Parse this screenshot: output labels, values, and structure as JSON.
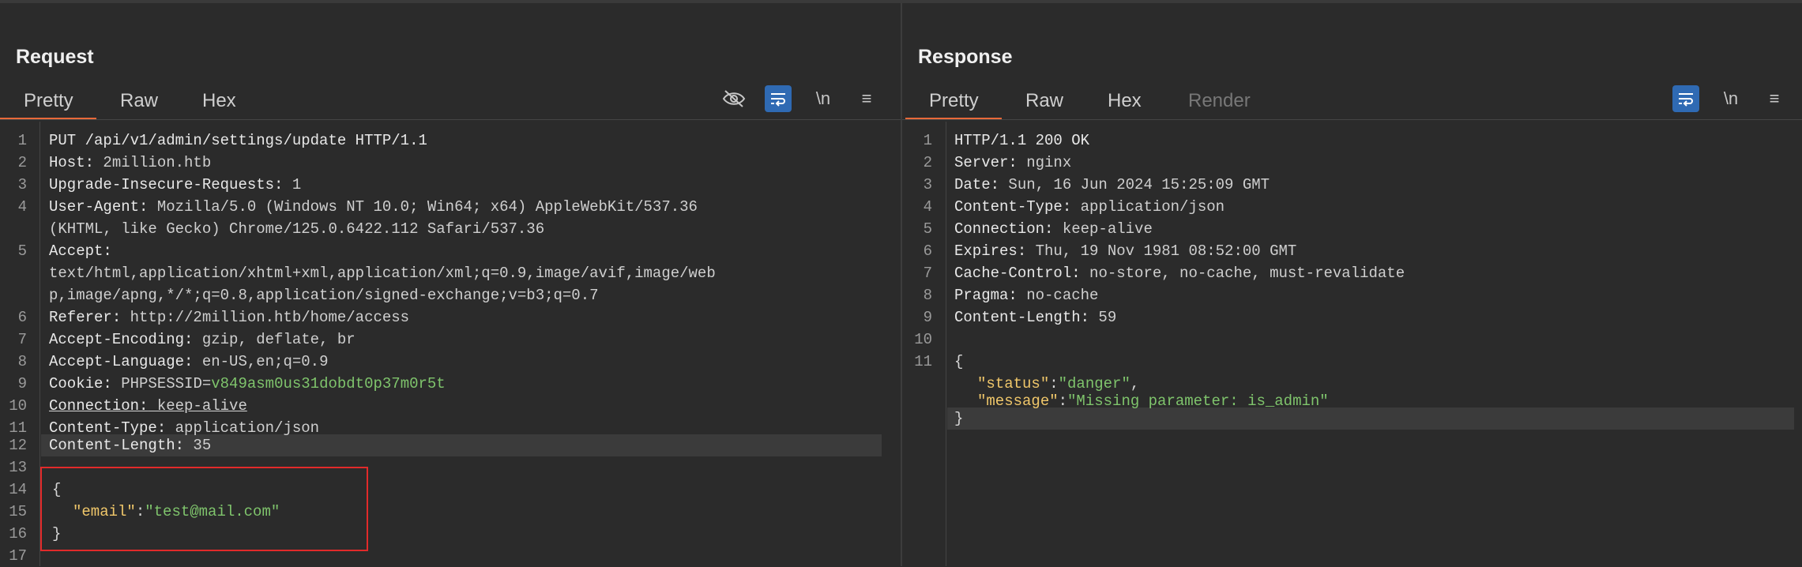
{
  "layout_switch": {
    "icons": [
      "split-horizontal-icon",
      "split-vertical-icon",
      "single-pane-icon"
    ],
    "active": 0
  },
  "request": {
    "title": "Request",
    "tabs": [
      {
        "label": "Pretty",
        "active": true
      },
      {
        "label": "Raw",
        "active": false
      },
      {
        "label": "Hex",
        "active": false
      }
    ],
    "toolbar": {
      "newline_label": "\\n",
      "menu_label": "≡"
    },
    "lines": [
      {
        "n": "1",
        "text": "PUT /api/v1/admin/settings/update HTTP/1.1"
      },
      {
        "n": "2",
        "name": "Host:",
        "value": " 2million.htb"
      },
      {
        "n": "3",
        "name": "Upgrade-Insecure-Requests:",
        "value": " 1"
      },
      {
        "n": "4",
        "name": "User-Agent:",
        "value": " Mozilla/5.0 (Windows NT 10.0; Win64; x64) AppleWebKit/537.36"
      },
      {
        "n": "",
        "text": "(KHTML, like Gecko) Chrome/125.0.6422.112 Safari/537.36"
      },
      {
        "n": "5",
        "name": "Accept:",
        "value": ""
      },
      {
        "n": "",
        "text": "text/html,application/xhtml+xml,application/xml;q=0.9,image/avif,image/web"
      },
      {
        "n": "",
        "text": "p,image/apng,*/*;q=0.8,application/signed-exchange;v=b3;q=0.7"
      },
      {
        "n": "6",
        "name": "Referer:",
        "value": " http://2million.htb/home/access"
      },
      {
        "n": "7",
        "name": "Accept-Encoding:",
        "value": " gzip, deflate, br"
      },
      {
        "n": "8",
        "name": "Accept-Language:",
        "value": " en-US,en;q=0.9"
      },
      {
        "n": "9",
        "name": "Cookie:",
        "value": " PHPSESSID=",
        "extra": "v849asm0us31dobdt0p37m0r5t"
      },
      {
        "n": "10",
        "name": "Connection:",
        "value": " keep-alive"
      },
      {
        "n": "11",
        "name": "Content-Type:",
        "value": " application/json"
      },
      {
        "n": "12",
        "name": "Content-Length:",
        "value": " 35"
      },
      {
        "n": "13",
        "text": ""
      },
      {
        "n": "14",
        "text": "{"
      },
      {
        "n": "15",
        "jkey": "\"email\"",
        "sep": ":",
        "jval": "\"test@mail.com\""
      },
      {
        "n": "16",
        "text": "}"
      },
      {
        "n": "17",
        "text": ""
      }
    ]
  },
  "response": {
    "title": "Response",
    "tabs": [
      {
        "label": "Pretty",
        "active": true
      },
      {
        "label": "Raw",
        "active": false
      },
      {
        "label": "Hex",
        "active": false
      },
      {
        "label": "Render",
        "active": false
      }
    ],
    "toolbar": {
      "newline_label": "\\n",
      "menu_label": "≡"
    },
    "lines": [
      {
        "n": "1",
        "text": "HTTP/1.1 200 OK"
      },
      {
        "n": "2",
        "name": "Server:",
        "value": " nginx"
      },
      {
        "n": "3",
        "name": "Date:",
        "value": " Sun, 16 Jun 2024 15:25:09 GMT"
      },
      {
        "n": "4",
        "name": "Content-Type:",
        "value": " application/json"
      },
      {
        "n": "5",
        "name": "Connection:",
        "value": " keep-alive"
      },
      {
        "n": "6",
        "name": "Expires:",
        "value": " Thu, 19 Nov 1981 08:52:00 GMT"
      },
      {
        "n": "7",
        "name": "Cache-Control:",
        "value": " no-store, no-cache, must-revalidate"
      },
      {
        "n": "8",
        "name": "Pragma:",
        "value": " no-cache"
      },
      {
        "n": "9",
        "name": "Content-Length:",
        "value": " 59"
      },
      {
        "n": "10",
        "text": ""
      },
      {
        "n": "11",
        "text": "{"
      },
      {
        "n": "",
        "jkey": "\"status\"",
        "sep": ":",
        "jval": "\"danger\"",
        "tail": ","
      },
      {
        "n": "",
        "jkey": "\"message\"",
        "sep": ":",
        "jval": "\"Missing parameter: is_admin\""
      },
      {
        "n": "",
        "text": "}"
      }
    ]
  },
  "colors": {
    "accent": "#e8693a",
    "active_button": "#2f6ab3",
    "json_key": "#f0c76a",
    "json_string": "#7fc46c",
    "highlight_box": "#e22a2a"
  }
}
